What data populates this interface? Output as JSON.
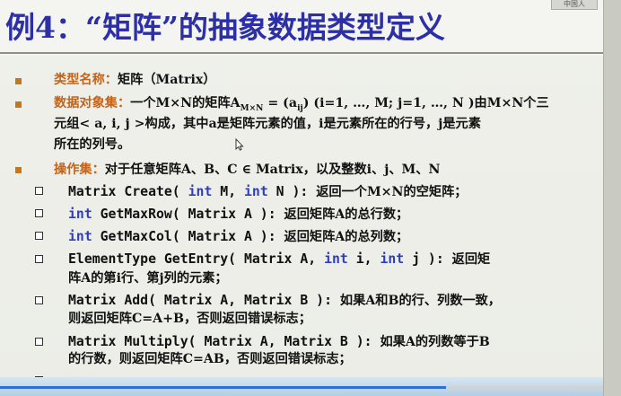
{
  "title": "例4：“矩阵”的抽象数据类型定义",
  "corner_label": "中国人",
  "type_name": {
    "label": "类型名称：",
    "value": "矩阵（Matrix）"
  },
  "data_set": {
    "label": "数据对象集：",
    "line1": "一个M×N的矩阵A",
    "line1_sub": "M×N",
    "line1_rest": " = (a",
    "line1_sub2": "ij",
    "line1_rest2": ")  (i=1, …, M; j=1, …, N )由M×N个三",
    "line2": "元组< a, i, j >构成，其中a是矩阵元素的值，i是元素所在的行号，j是元素",
    "line3": "所在的列号。"
  },
  "ops": {
    "label": "操作集：",
    "intro": "对于任意矩阵A、B、C ∈ Matrix，以及整数i、j、M、N",
    "items": [
      {
        "p1": "Matrix Create( ",
        "k1": "int",
        "p2": " M, ",
        "k2": "int",
        "p3": " N ): ",
        "desc": "返回一个M×N的空矩阵；"
      },
      {
        "k0": "int",
        "p1": " GetMaxRow( Matrix A ): ",
        "desc": "返回矩阵A的总行数；"
      },
      {
        "k0": "int",
        "p1": " GetMaxCol( Matrix A ): ",
        "desc": "返回矩阵A的总列数；"
      },
      {
        "p1": "ElementType GetEntry( Matrix A, ",
        "k1": "int",
        "p2": " i, ",
        "k2": "int",
        "p3": " j ): ",
        "desc": "返回矩",
        "desc2": "阵A的第i行、第j列的元素；"
      },
      {
        "p1": "Matrix Add( Matrix A, Matrix B ): ",
        "desc": "如果A和B的行、列数一致，",
        "desc2": "则返回矩阵C=A+B，否则返回错误标志；"
      },
      {
        "p1": "Matrix Multiply( Matrix A, Matrix B ): ",
        "desc": "如果A的列数等于B",
        "desc2": "的行数，则返回矩阵C=AB，否则返回错误标志；"
      },
      {
        "p1": "……"
      }
    ]
  },
  "playback": {
    "progress": 0.74
  },
  "colors": {
    "title": "#2d2fa6",
    "label": "#c2641a",
    "keyword": "#2d3fb8",
    "progress": "#2d6fd2"
  }
}
